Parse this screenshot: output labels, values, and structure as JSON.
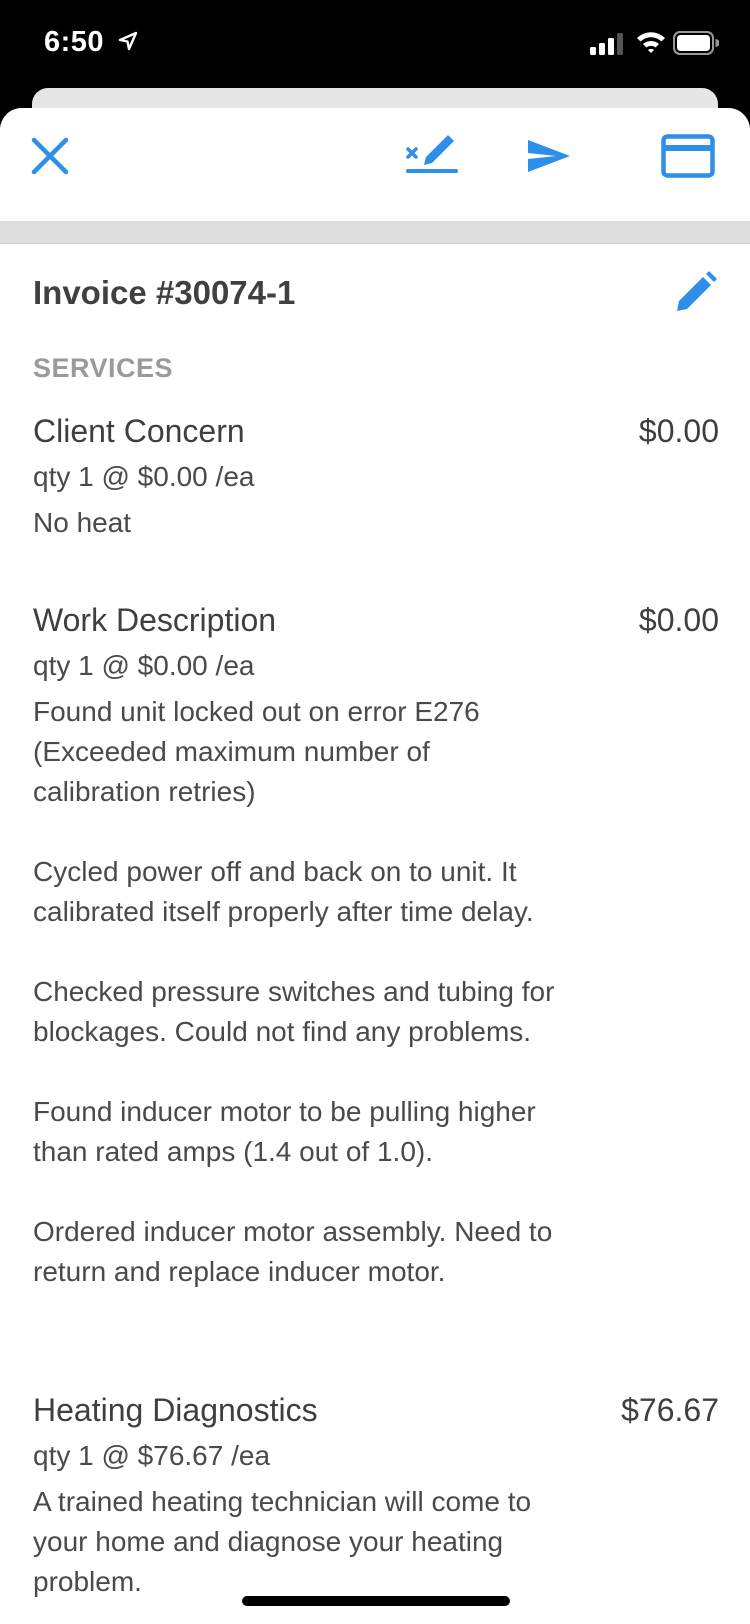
{
  "status_bar": {
    "time": "6:50"
  },
  "toolbar": {
    "close_icon": "close-icon",
    "sign_icon": "signature-icon",
    "send_icon": "send-icon",
    "payment_icon": "credit-card-icon",
    "accent": "#2E8FEA"
  },
  "invoice": {
    "title": "Invoice #30074-1"
  },
  "services": {
    "label": "SERVICES",
    "items": [
      {
        "name": "Client Concern",
        "price": "$0.00",
        "qty": "qty 1 @ $0.00 /ea",
        "description": "No heat"
      },
      {
        "name": "Work Description",
        "price": "$0.00",
        "qty": "qty 1 @ $0.00 /ea",
        "description": "Found unit locked out on error E276\n(Exceeded maximum number of\ncalibration retries)\n\nCycled power off and back on to unit. It\ncalibrated itself properly after time delay.\n\nChecked pressure switches and tubing for\nblockages. Could not find any problems.\n\nFound inducer motor to be pulling higher\nthan rated amps (1.4 out of 1.0).\n\nOrdered inducer motor assembly. Need to\nreturn and replace inducer motor."
      },
      {
        "name": "Heating Diagnostics",
        "price": "$76.67",
        "qty": "qty 1 @ $76.67 /ea",
        "description": "A trained heating technician will come to\nyour home and diagnose your heating\nproblem."
      }
    ]
  }
}
